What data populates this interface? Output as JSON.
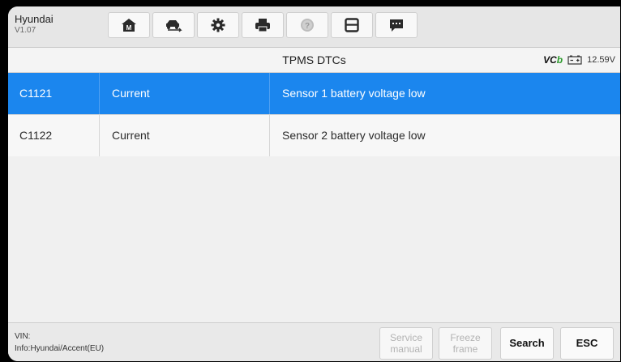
{
  "vehicle": {
    "make": "Hyundai",
    "version": "V1.07"
  },
  "toolbar": {
    "icons": [
      "home-icon",
      "vehicle-swap-icon",
      "settings-gear-icon",
      "print-icon",
      "help-icon",
      "save-icon",
      "data-logging-icon"
    ]
  },
  "title": "TPMS DTCs",
  "status": {
    "vci_label": "VC",
    "vci_suffix": "b",
    "battery_voltage": "12.59V"
  },
  "dtcs": [
    {
      "code": "C1121",
      "status": "Current",
      "description": "Sensor 1 battery voltage low",
      "selected": true
    },
    {
      "code": "C1122",
      "status": "Current",
      "description": "Sensor 2 battery voltage low",
      "selected": false
    }
  ],
  "footer": {
    "vin_label": "VIN:",
    "info": "Info:Hyundai/Accent(EU)",
    "buttons": {
      "service_manual": "Service manual",
      "freeze_frame": "Freeze frame",
      "search": "Search",
      "esc": "ESC"
    }
  },
  "colors": {
    "selected_row": "#1b86ee",
    "vci_green": "#2e9b2e"
  }
}
